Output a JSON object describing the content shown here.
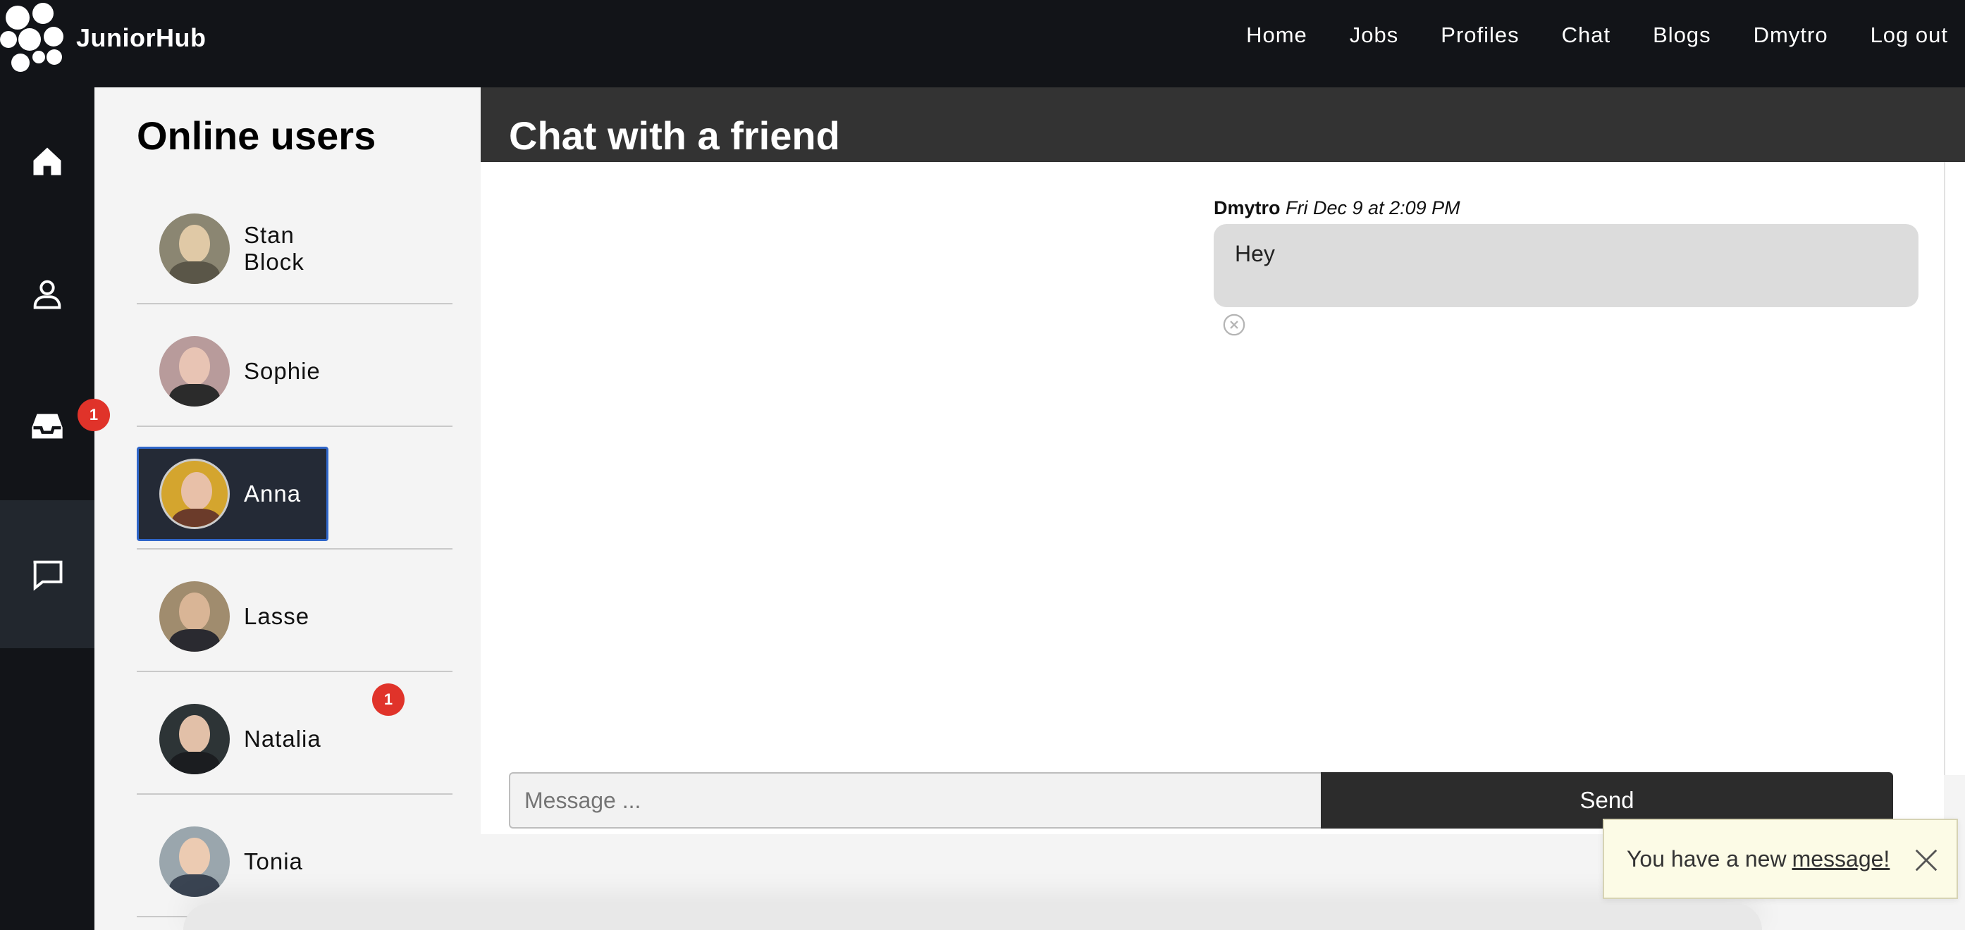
{
  "brand": {
    "name": "JuniorHub"
  },
  "nav": {
    "items": [
      "Home",
      "Jobs",
      "Profiles",
      "Chat",
      "Blogs",
      "Dmytro",
      "Log out"
    ]
  },
  "rail": {
    "icons": [
      "home-icon",
      "user-icon",
      "inbox-icon",
      "chat-icon"
    ],
    "chat_badge": "1"
  },
  "users_panel": {
    "title": "Online users",
    "users": [
      {
        "name": "Stan Block",
        "selected": false,
        "badge": ""
      },
      {
        "name": "Sophie",
        "selected": false,
        "badge": ""
      },
      {
        "name": "Anna",
        "selected": true,
        "badge": ""
      },
      {
        "name": "Lasse",
        "selected": false,
        "badge": ""
      },
      {
        "name": "Natalia",
        "selected": false,
        "badge": "1"
      },
      {
        "name": "Tonia",
        "selected": false,
        "badge": ""
      }
    ]
  },
  "chat": {
    "title": "Chat with a friend",
    "messages": [
      {
        "author": "Dmytro",
        "timestamp": "Fri Dec 9 at 2:09 PM",
        "text": "Hey"
      }
    ],
    "composer": {
      "placeholder": "Message ...",
      "send_label": "Send"
    }
  },
  "toast": {
    "text": "You have a new",
    "link": "message!"
  },
  "colors": {
    "navbar": "#121418",
    "badge": "#e0332a",
    "selected_user": "#242a36",
    "selected_border": "#2f66c9",
    "chat_header": "#333333",
    "send_button": "#2c2c2c",
    "toast_bg": "#fcfbe6"
  }
}
